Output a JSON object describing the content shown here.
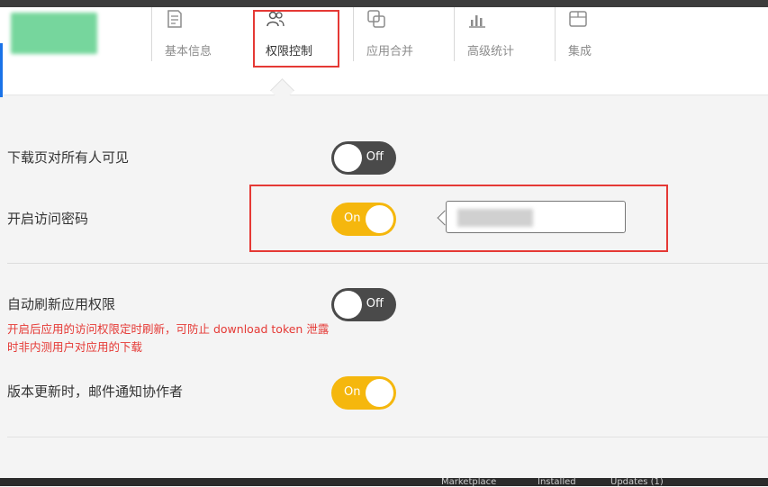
{
  "tabs": [
    {
      "label": "基本信息",
      "icon": "document-icon"
    },
    {
      "label": "权限控制",
      "icon": "users-icon",
      "active": true
    },
    {
      "label": "应用合并",
      "icon": "merge-icon"
    },
    {
      "label": "高级统计",
      "icon": "chart-icon"
    },
    {
      "label": "集成",
      "icon": "box-icon"
    }
  ],
  "settings": {
    "public_download": {
      "label": "下载页对所有人可见",
      "toggle": "Off"
    },
    "access_password": {
      "label": "开启访问密码",
      "toggle": "On",
      "password_value": ""
    },
    "auto_refresh": {
      "label": "自动刷新应用权限",
      "toggle": "Off",
      "hint": "开启后应用的访问权限定时刷新，可防止 download token 泄露时非内测用户对应用的下载"
    },
    "notify_collaborators": {
      "label": "版本更新时，邮件通知协作者",
      "toggle": "On"
    }
  },
  "taskbar": {
    "marketplace": "Marketplace",
    "installed": "Installed",
    "updates": "Updates (1)"
  },
  "colors": {
    "on": "#f5b70d",
    "off": "#4a4a4a",
    "highlight": "#e53935",
    "hint": "#e53935"
  }
}
